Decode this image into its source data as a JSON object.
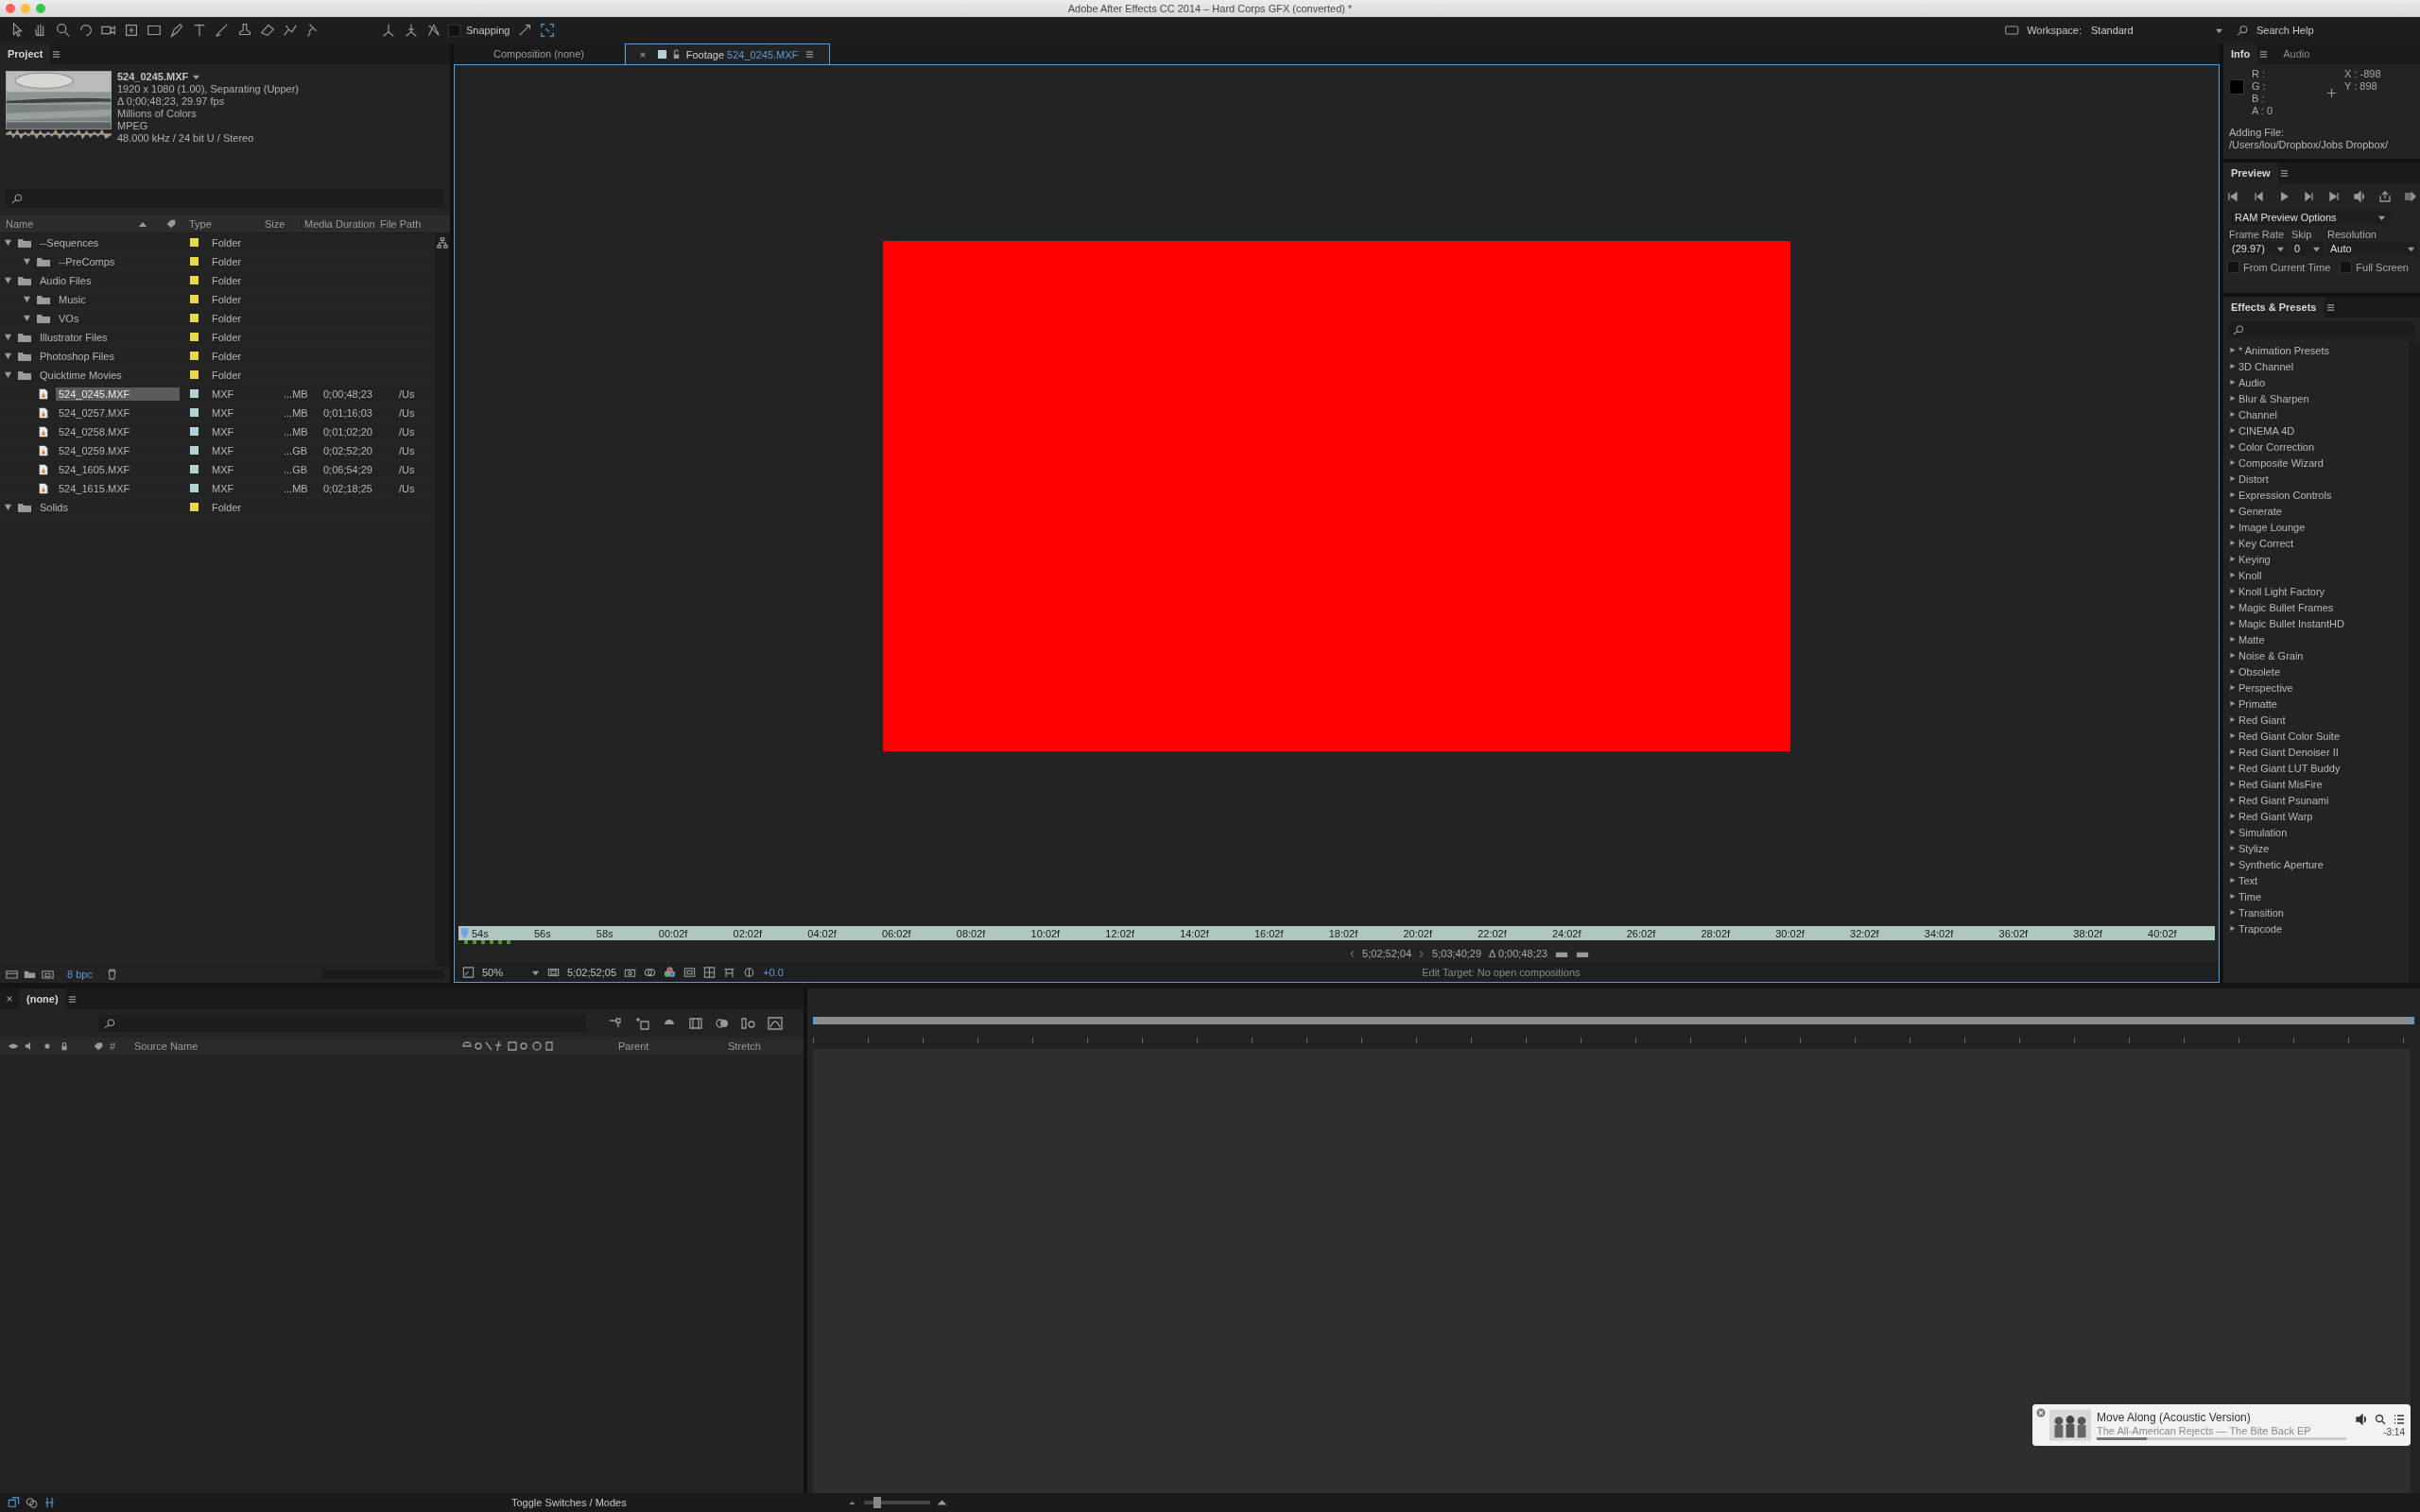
{
  "window": {
    "title": "Adobe After Effects CC 2014 – Hard Corps GFX (converted) *"
  },
  "toolbar": {
    "snapping": {
      "label": "Snapping",
      "checked": false
    },
    "workspace_label": "Workspace:",
    "workspace": "Standard",
    "search": {
      "placeholder": "Search Help"
    }
  },
  "project": {
    "tab": "Project",
    "footage": {
      "name": "524_0245.MXF",
      "lines": [
        "1920 x 1080 (1.00), Separating (Upper)",
        "Δ 0;00;48;23, 29.97 fps",
        "Millions of Colors",
        "MPEG",
        "48.000 kHz / 24 bit U / Stereo"
      ]
    },
    "columns": [
      "Name",
      "Type",
      "Size",
      "Media Duration",
      "File Path"
    ],
    "items": [
      {
        "kind": "folder",
        "name": "--Sequences",
        "type": "Folder",
        "color": "#e6d84a",
        "expanded": true,
        "selected": false,
        "children": [
          {
            "kind": "folder",
            "name": "--PreComps",
            "type": "Folder",
            "color": "#e6d84a",
            "expanded": true,
            "selected": false
          }
        ]
      },
      {
        "kind": "folder",
        "name": "Audio Files",
        "type": "Folder",
        "color": "#e6d84a",
        "expanded": true,
        "selected": false,
        "children": [
          {
            "kind": "folder",
            "name": "Music",
            "type": "Folder",
            "color": "#e6d84a",
            "expanded": true,
            "selected": false
          },
          {
            "kind": "folder",
            "name": "VOs",
            "type": "Folder",
            "color": "#e6d84a",
            "expanded": true,
            "selected": false
          }
        ]
      },
      {
        "kind": "folder",
        "name": "Illustrator Files",
        "type": "Folder",
        "color": "#e6d84a",
        "expanded": true,
        "selected": false
      },
      {
        "kind": "folder",
        "name": "Photoshop Files",
        "type": "Folder",
        "color": "#e6d84a",
        "expanded": true,
        "selected": false
      },
      {
        "kind": "folder",
        "name": "Quicktime Movies",
        "type": "Folder",
        "color": "#e6d84a",
        "expanded": true,
        "selected": false,
        "children": [
          {
            "kind": "footage",
            "name": "524_0245.MXF",
            "type": "MXF",
            "size": "...MB",
            "duration": "0;00;48;23",
            "path": "/Us",
            "color": "#b4d2d2",
            "selected": true
          },
          {
            "kind": "footage",
            "name": "524_0257.MXF",
            "type": "MXF",
            "size": "...MB",
            "duration": "0;01;16;03",
            "path": "/Us",
            "color": "#b4d2d2",
            "selected": false
          },
          {
            "kind": "footage",
            "name": "524_0258.MXF",
            "type": "MXF",
            "size": "...MB",
            "duration": "0;01;02;20",
            "path": "/Us",
            "color": "#b4d2d2",
            "selected": false
          },
          {
            "kind": "footage",
            "name": "524_0259.MXF",
            "type": "MXF",
            "size": "...GB",
            "duration": "0;02;52;20",
            "path": "/Us",
            "color": "#b4d2d2",
            "selected": false
          },
          {
            "kind": "footage",
            "name": "524_1605.MXF",
            "type": "MXF",
            "size": "...GB",
            "duration": "0;06;54;29",
            "path": "/Us",
            "color": "#b4d2d2",
            "selected": false
          },
          {
            "kind": "footage",
            "name": "524_1615.MXF",
            "type": "MXF",
            "size": "...MB",
            "duration": "0;02;18;25",
            "path": "/Us",
            "color": "#b4d2d2",
            "selected": false
          }
        ]
      },
      {
        "kind": "folder",
        "name": "Solids",
        "type": "Folder",
        "color": "#e6d84a",
        "expanded": true,
        "selected": false
      }
    ],
    "bit_depth": "8 bpc"
  },
  "viewer": {
    "tabs": [
      {
        "label": "Composition (none)",
        "selected": false
      },
      {
        "label": "Footage",
        "file": "524_0245.MXF",
        "selected": true
      }
    ],
    "ruler": [
      "54s",
      "56s",
      "58s",
      "00:02f",
      "02:02f",
      "04:02f",
      "06:02f",
      "08:02f",
      "10:02f",
      "12:02f",
      "14:02f",
      "16:02f",
      "18:02f",
      "20:02f",
      "22:02f",
      "24:02f",
      "26:02f",
      "28:02f",
      "30:02f",
      "32:02f",
      "34:02f",
      "36:02f",
      "38:02f",
      "40:02f"
    ],
    "in_point": "5;02;52;04",
    "out_point": "5;03;40;29",
    "duration": "Δ 0;00;48;23",
    "zoom": "50%",
    "timecode": "5;02;52;05",
    "exposure": "+0.0",
    "edit_target": "Edit Target: No open compositions"
  },
  "info": {
    "tabs": [
      {
        "label": "Info",
        "selected": true
      },
      {
        "label": "Audio",
        "selected": false
      }
    ],
    "channels": [
      "R :",
      "G :",
      "B :",
      "A : 0"
    ],
    "coords": [
      "X : -898",
      "Y : 898"
    ],
    "status": "Adding File:",
    "path": "/Users/lou/Dropbox/Jobs Dropbox/"
  },
  "preview": {
    "tab": "Preview",
    "options": "RAM Preview Options",
    "labels": [
      "Frame Rate",
      "Skip",
      "Resolution"
    ],
    "values": [
      "(29.97)",
      "0",
      "Auto"
    ],
    "checkboxes": [
      {
        "label": "From Current Time",
        "checked": false
      },
      {
        "label": "Full Screen",
        "checked": false
      }
    ]
  },
  "effects": {
    "tab": "Effects & Presets",
    "categories": [
      "* Animation Presets",
      "3D Channel",
      "Audio",
      "Blur & Sharpen",
      "Channel",
      "CINEMA 4D",
      "Color Correction",
      "Composite Wizard",
      "Distort",
      "Expression Controls",
      "Generate",
      "Image Lounge",
      "Key Correct",
      "Keying",
      "Knoll",
      "Knoll Light Factory",
      "Magic Bullet Frames",
      "Magic Bullet InstantHD",
      "Matte",
      "Noise & Grain",
      "Obsolete",
      "Perspective",
      "Primatte",
      "Red Giant",
      "Red Giant Color Suite",
      "Red Giant Denoiser II",
      "Red Giant LUT Buddy",
      "Red Giant MisFire",
      "Red Giant Psunami",
      "Red Giant Warp",
      "Simulation",
      "Stylize",
      "Synthetic Aperture",
      "Text",
      "Time",
      "Transition",
      "Trapcode"
    ]
  },
  "timeline": {
    "tab": "(none)",
    "columns": [
      "#",
      "Source Name",
      "Parent",
      "Stretch"
    ],
    "toggle": "Toggle Switches / Modes",
    "zoom": {
      "level": 0.2
    }
  },
  "player": {
    "title": "Move Along (Acoustic Version)",
    "artist": "The All-American Rejects — The Bite Back EP",
    "remaining": "-3:14",
    "level": 0.2
  }
}
